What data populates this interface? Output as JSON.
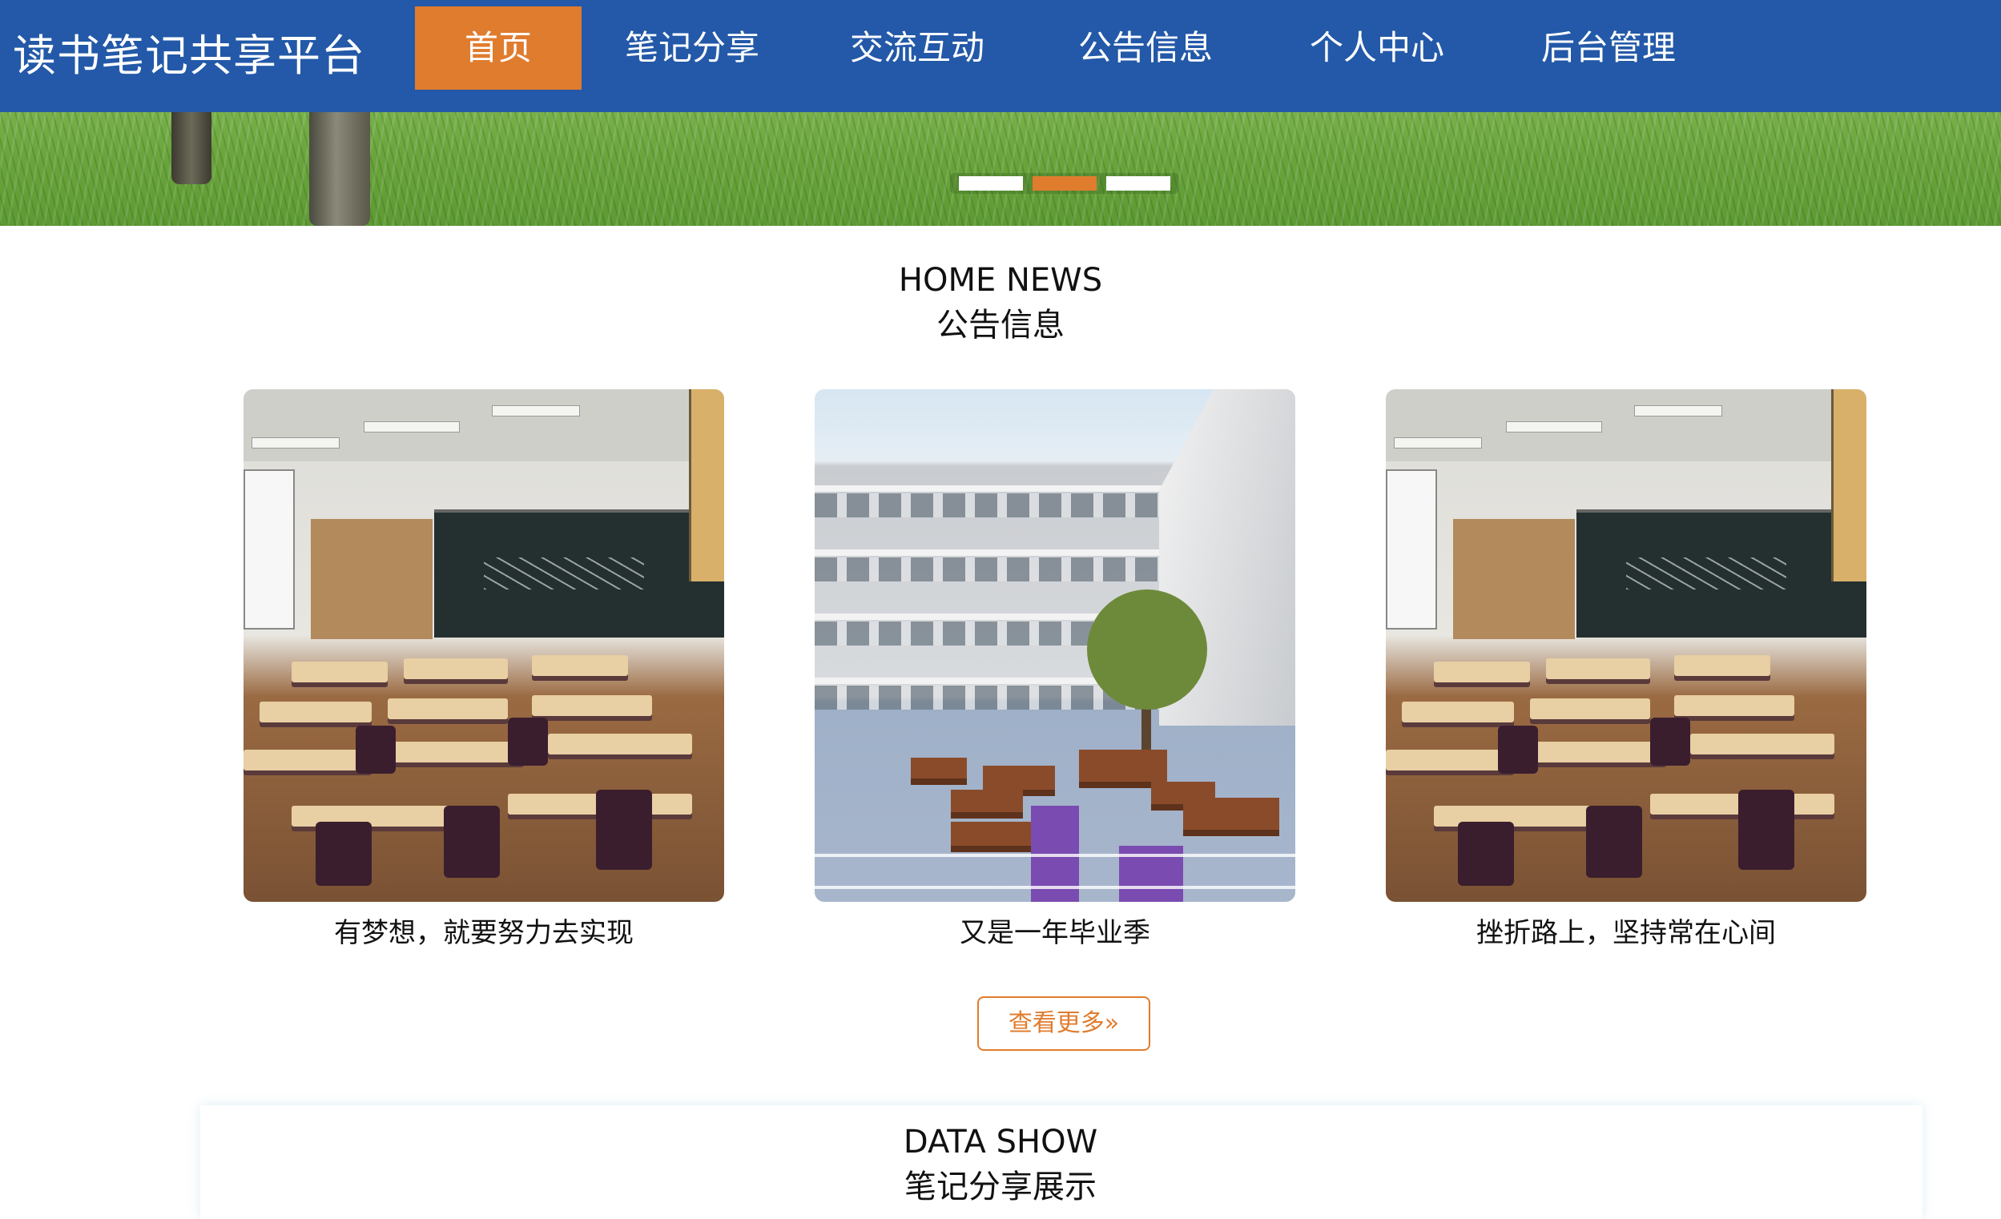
{
  "header": {
    "site_title": "读书笔记共享平台",
    "nav": [
      {
        "label": "首页",
        "active": true
      },
      {
        "label": "笔记分享",
        "active": false
      },
      {
        "label": "交流互动",
        "active": false
      },
      {
        "label": "公告信息",
        "active": false
      },
      {
        "label": "个人中心",
        "active": false
      },
      {
        "label": "后台管理",
        "active": false
      }
    ]
  },
  "banner": {
    "carousel_dots": 3,
    "active_dot": 2
  },
  "news": {
    "heading_en": "HOME NEWS",
    "heading_cn": "公告信息",
    "items": [
      {
        "title": "有梦想，就要努力去实现",
        "image": "classroom-photo"
      },
      {
        "title": "又是一年毕业季",
        "image": "courtyard-photo"
      },
      {
        "title": "挫折路上，坚持常在心间",
        "image": "classroom-photo"
      }
    ],
    "more_label": "查看更多»"
  },
  "data_show": {
    "heading_en": "DATA SHOW",
    "heading_cn": "笔记分享展示"
  },
  "colors": {
    "header_bg": "#2359a8",
    "accent": "#e07c2e",
    "text": "#111111"
  }
}
